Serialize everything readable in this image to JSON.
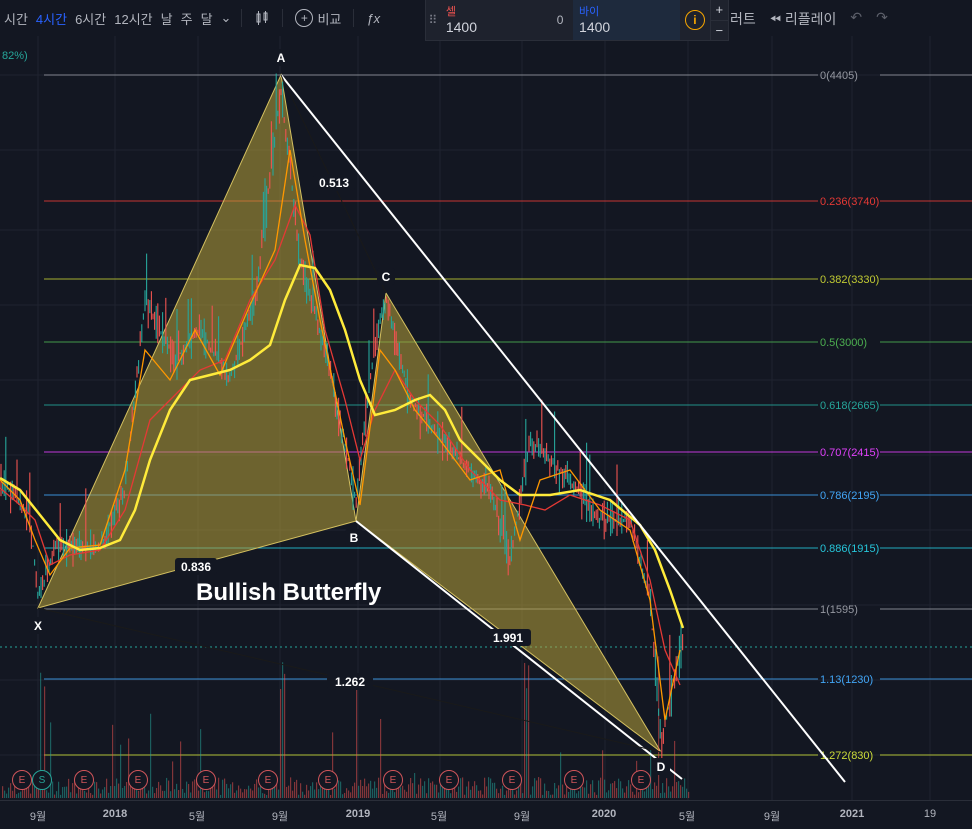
{
  "toolbar": {
    "timeframes": [
      "시간",
      "4시간",
      "6시간",
      "12시간",
      "날",
      "주",
      "달"
    ],
    "active_timeframe": "4시간",
    "compare_label": "비교",
    "chart_label": "러트",
    "replay_label": "리플레이"
  },
  "trade_panel": {
    "sell_label": "셀",
    "sell_price": "1400",
    "spread": "0",
    "buy_label": "바이",
    "buy_price": "1400",
    "info_icon": "i",
    "plus": "+",
    "minus": "−"
  },
  "percent_label": "82%)",
  "pattern": {
    "title": "Bullish Butterfly",
    "points": {
      "X": "X",
      "A": "A",
      "B": "B",
      "C": "C",
      "D": "D"
    },
    "ratios": {
      "xab": "0.836",
      "abc": "0.513",
      "bcd": "1.991",
      "xad": "1.262"
    }
  },
  "fib_levels": [
    {
      "label": "0(4405)",
      "color": "#9598a1"
    },
    {
      "label": "0.236(3740)",
      "color": "#e53935"
    },
    {
      "label": "0.382(3330)",
      "color": "#c0ca33"
    },
    {
      "label": "0.5(3000)",
      "color": "#4caf50"
    },
    {
      "label": "0.618(2665)",
      "color": "#26a69a"
    },
    {
      "label": "0.707(2415)",
      "color": "#e040fb"
    },
    {
      "label": "0.786(2195)",
      "color": "#42a5f5"
    },
    {
      "label": "0.886(1915)",
      "color": "#26c6da"
    },
    {
      "label": "1(1595)",
      "color": "#9598a1"
    },
    {
      "label": "1.13(1230)",
      "color": "#42a5f5"
    },
    {
      "label": "1.272(830)",
      "color": "#cddc39"
    }
  ],
  "x_axis": [
    "9월",
    "2018",
    "5월",
    "9월",
    "2019",
    "5월",
    "9월",
    "2020",
    "5월",
    "9월",
    "2021",
    "19"
  ],
  "events": [
    "E",
    "S",
    "E",
    "E",
    "E",
    "E",
    "E",
    "E",
    "E",
    "E",
    "E",
    "E"
  ],
  "colors": {
    "pattern_fill": "#b8a33a",
    "trendline": "#ffffff",
    "ma_yellow": "#ffeb3b",
    "ma_orange": "#ff9800",
    "ma_red": "#e53935",
    "candle_up": "#26a69a",
    "candle_down": "#ef5350"
  }
}
